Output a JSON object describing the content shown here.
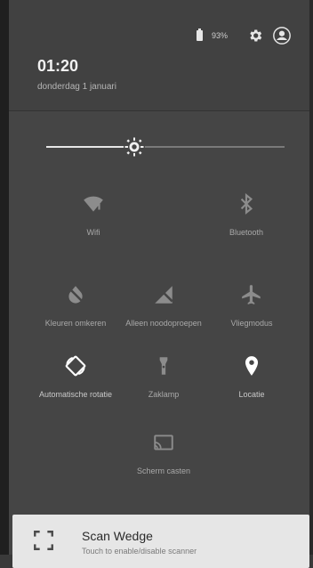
{
  "status": {
    "battery_level": "93%",
    "time": "01:20",
    "date": "donderdag 1 januari"
  },
  "brightness": {
    "level": 0.37
  },
  "tiles": [
    {
      "label": "Wifi",
      "icon": "wifi-icon",
      "state": "off"
    },
    {
      "label": "Bluetooth",
      "icon": "bluetooth-icon",
      "state": "off"
    },
    {
      "label": "Kleuren omkeren",
      "icon": "invert-colors-icon",
      "state": "off"
    },
    {
      "label": "Alleen noodoproepen",
      "icon": "no-signal-icon",
      "state": "off"
    },
    {
      "label": "Vliegmodus",
      "icon": "airplane-icon",
      "state": "off"
    },
    {
      "label": "Automatische rotatie",
      "icon": "rotate-icon",
      "state": "on"
    },
    {
      "label": "Zaklamp",
      "icon": "flashlight-icon",
      "state": "off"
    },
    {
      "label": "Locatie",
      "icon": "location-icon",
      "state": "on"
    },
    {
      "label": "Scherm casten",
      "icon": "cast-icon",
      "state": "off"
    }
  ],
  "notification": {
    "title": "Scan Wedge",
    "subtitle": "Touch to enable/disable scanner",
    "icon": "scan-frame-icon"
  }
}
